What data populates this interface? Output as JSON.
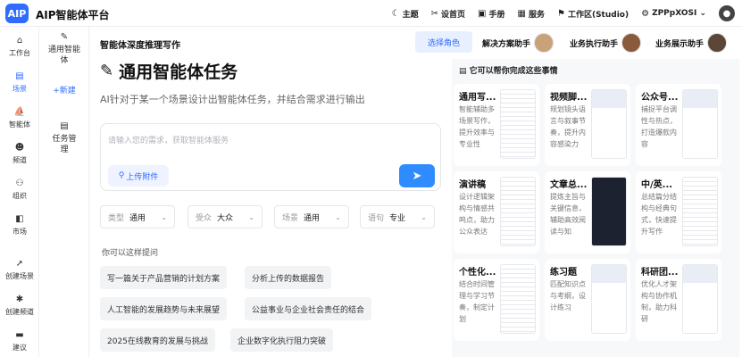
{
  "app": {
    "logo": "AIP",
    "title": "AIP智能体平台"
  },
  "topnav": [
    {
      "icon": "☾",
      "label": "主题"
    },
    {
      "icon": "✂",
      "label": "设首页"
    },
    {
      "icon": "▣",
      "label": "手册"
    },
    {
      "icon": "▦",
      "label": "服务"
    },
    {
      "icon": "⚑",
      "label": "工作区(Studio)"
    },
    {
      "icon": "⚙",
      "label": "ZPPpXOSI ⌄"
    }
  ],
  "leftnav": [
    {
      "icon": "⌂",
      "label": "工作台"
    },
    {
      "icon": "▤",
      "label": "场景"
    },
    {
      "icon": "⛵",
      "label": "智能体"
    },
    {
      "icon": "☻",
      "label": "频道"
    },
    {
      "icon": "⚇",
      "label": "组织"
    },
    {
      "icon": "◧",
      "label": "市场"
    },
    {
      "icon": "➚",
      "label": "创建场景"
    },
    {
      "icon": "✱",
      "label": "创建频道"
    },
    {
      "icon": "▬",
      "label": "建议"
    }
  ],
  "subnav": {
    "agent_icon": "✎",
    "agent": "通用智能体",
    "new": "+新建",
    "task_icon": "▤",
    "task": "任务管理"
  },
  "header": {
    "title": "智能体深度推理写作",
    "role_button": "选择角色",
    "helpers": [
      "解决方案助手",
      "业务执行助手",
      "业务展示助手"
    ]
  },
  "hero": {
    "icon": "✎",
    "title": "通用智能体任务",
    "description": "AI针对于某一个场景设计出智能体任务，并结合需求进行输出"
  },
  "input": {
    "placeholder": "请输入您的需求，获取智能体服务",
    "attach_label": "上传附件",
    "attach_icon": "⚲",
    "send_icon": "➤"
  },
  "filters": [
    {
      "key": "类型",
      "value": "通用"
    },
    {
      "key": "受众",
      "value": "大众"
    },
    {
      "key": "场景",
      "value": "通用"
    },
    {
      "key": "语句",
      "value": "专业"
    }
  ],
  "suggest_label": "你可以这样提问",
  "suggestions": [
    "写一篇关于产品营销的计划方案",
    "分析上传的数据报告",
    "人工智能的发展趋势与未来展望",
    "公益事业与企业社会责任的结合",
    "2025在线教育的发展与挑战",
    "企业数字化执行阻力突破"
  ],
  "panel": {
    "title": "它可以帮你完成这些事情",
    "cards": [
      {
        "title": "通用写...",
        "desc": "智能辅助多场景写作，提升效率与专业性"
      },
      {
        "title": "视频脚...",
        "desc": "规划镜头语言与叙事节奏，提升内容感染力"
      },
      {
        "title": "公众号...",
        "desc": "捕捉平台调性与热点，打造爆款内容"
      },
      {
        "title": "演讲稿",
        "desc": "设计逻辑架构与情感共鸣点，助力公众表达"
      },
      {
        "title": "文章总...",
        "desc": "提炼主旨与关键信息，辅助高效阅读与知"
      },
      {
        "title": "中/英...",
        "desc": "总结篇分结构与经典句式，快速提升写作"
      },
      {
        "title": "个性化...",
        "desc": "结合时间管理与学习节奏，制定计划"
      },
      {
        "title": "练习题",
        "desc": "匹配知识点与考纲，设计练习"
      },
      {
        "title": "科研团...",
        "desc": "优化人才架构与协作机制，助力科研"
      }
    ]
  }
}
